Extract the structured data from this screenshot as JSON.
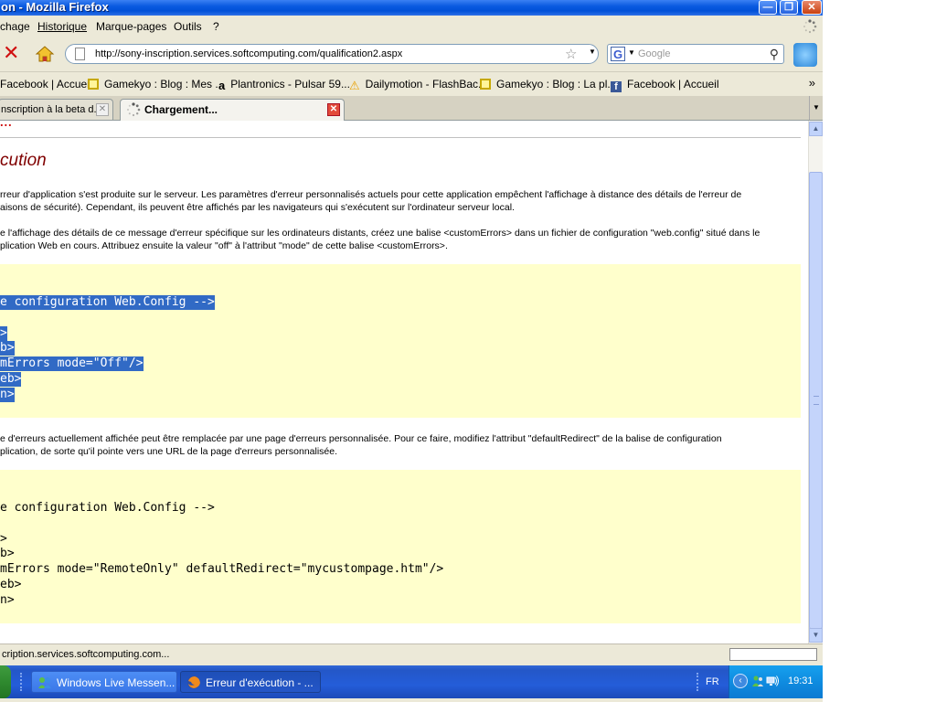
{
  "window": {
    "title": "on - Mozilla Firefox"
  },
  "menu": {
    "items": [
      "chage",
      "Historique",
      "Marque-pages",
      "Outils",
      "?"
    ]
  },
  "nav": {
    "url": "http://sony-inscription.services.softcomputing.com/qualification2.aspx",
    "search_placeholder": "Google"
  },
  "bookmarks": [
    {
      "label": "Facebook | Accueil",
      "icon": "none"
    },
    {
      "label": "Gamekyo : Blog : Mes ...",
      "icon": "gamekyo-icon"
    },
    {
      "label": "Plantronics - Pulsar 59...",
      "icon": "amazon-icon"
    },
    {
      "label": "Dailymotion - FlashBac...",
      "icon": "dailymotion-icon"
    },
    {
      "label": "Gamekyo : Blog : La pl...",
      "icon": "gamekyo-icon"
    },
    {
      "label": "Facebook | Accueil",
      "icon": "facebook-icon"
    }
  ],
  "bookmarks_more": "»",
  "tabs": [
    {
      "label": "nscription à la beta d...",
      "active": false
    },
    {
      "label": "Chargement...",
      "active": true
    }
  ],
  "page": {
    "top_fragment": "...",
    "heading": "cution",
    "paragraph1": [
      "rreur d'application s'est produite sur le serveur. Les paramètres d'erreur personnalisés actuels pour cette application empêchent l'affichage à distance des détails de l'erreur de",
      "aisons de sécurité). Cependant, ils peuvent être affichés par les navigateurs qui s'exécutent sur l'ordinateur serveur local."
    ],
    "paragraph2": [
      "e l'affichage des détails de ce message d'erreur spécifique sur les ordinateurs distants, créez une balise <customErrors> dans un fichier de configuration \"web.config\" situé dans le",
      "plication Web en cours. Attribuez ensuite la valeur \"off\" à l'attribut \"mode\" de cette balise <customErrors>."
    ],
    "code1": [
      "e configuration Web.Config -->",
      ">",
      "b>",
      "mErrors mode=\"Off\"/>",
      "eb>",
      "n>"
    ],
    "paragraph3": [
      "e d'erreurs actuellement affichée peut être remplacée par une page d'erreurs personnalisée. Pour ce faire, modifiez l'attribut \"defaultRedirect\" de la balise de configuration",
      "plication, de sorte qu'il pointe vers une URL de la page d'erreurs personnalisée."
    ],
    "code2": [
      "e configuration Web.Config -->",
      ">",
      "b>",
      "mErrors mode=\"RemoteOnly\" defaultRedirect=\"mycustompage.htm\"/>",
      "eb>",
      "n>"
    ]
  },
  "status": {
    "text": "cription.services.softcomputing.com..."
  },
  "taskbar": {
    "buttons": [
      {
        "label": "Windows Live Messen...",
        "active": false
      },
      {
        "label": "Erreur d'exécution - ...",
        "active": true
      }
    ],
    "language": "FR",
    "clock": "19:31"
  },
  "colors": {
    "heading": "#800000",
    "code_background": "#ffffcc",
    "selection": "#316ac5"
  }
}
